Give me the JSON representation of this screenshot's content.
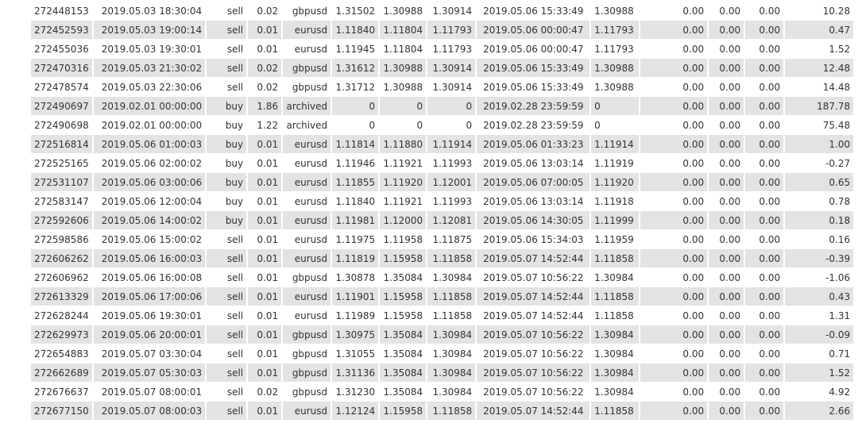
{
  "rows": [
    [
      "272448153",
      "2019.05.03 18:30:04",
      "sell",
      "0.02",
      "gbpusd",
      "1.31502",
      "1.30988",
      "1.30914",
      "2019.05.06 15:33:49",
      "1.30988",
      "0.00",
      "0.00",
      "0.00",
      "10.28"
    ],
    [
      "272452593",
      "2019.05.03 19:00:14",
      "sell",
      "0.01",
      "eurusd",
      "1.11840",
      "1.11804",
      "1.11793",
      "2019.05.06 00:00:47",
      "1.11793",
      "0.00",
      "0.00",
      "0.00",
      "0.47"
    ],
    [
      "272455036",
      "2019.05.03 19:30:01",
      "sell",
      "0.01",
      "eurusd",
      "1.11945",
      "1.11804",
      "1.11793",
      "2019.05.06 00:00:47",
      "1.11793",
      "0.00",
      "0.00",
      "0.00",
      "1.52"
    ],
    [
      "272470316",
      "2019.05.03 21:30:02",
      "sell",
      "0.02",
      "gbpusd",
      "1.31612",
      "1.30988",
      "1.30914",
      "2019.05.06 15:33:49",
      "1.30988",
      "0.00",
      "0.00",
      "0.00",
      "12.48"
    ],
    [
      "272478574",
      "2019.05.03 22:30:06",
      "sell",
      "0.02",
      "gbpusd",
      "1.31712",
      "1.30988",
      "1.30914",
      "2019.05.06 15:33:49",
      "1.30988",
      "0.00",
      "0.00",
      "0.00",
      "14.48"
    ],
    [
      "272490697",
      "2019.02.01 00:00:00",
      "buy",
      "1.86",
      "archived",
      "0",
      "0",
      "0",
      "2019.02.28 23:59:59",
      "0",
      "0.00",
      "0.00",
      "0.00",
      "187.78"
    ],
    [
      "272490698",
      "2019.02.01 00:00:00",
      "buy",
      "1.22",
      "archived",
      "0",
      "0",
      "0",
      "2019.02.28 23:59:59",
      "0",
      "0.00",
      "0.00",
      "0.00",
      "75.48"
    ],
    [
      "272516814",
      "2019.05.06 01:00:03",
      "buy",
      "0.01",
      "eurusd",
      "1.11814",
      "1.11880",
      "1.11914",
      "2019.05.06 01:33:23",
      "1.11914",
      "0.00",
      "0.00",
      "0.00",
      "1.00"
    ],
    [
      "272525165",
      "2019.05.06 02:00:02",
      "buy",
      "0.01",
      "eurusd",
      "1.11946",
      "1.11921",
      "1.11993",
      "2019.05.06 13:03:14",
      "1.11919",
      "0.00",
      "0.00",
      "0.00",
      "-0.27"
    ],
    [
      "272531107",
      "2019.05.06 03:00:06",
      "buy",
      "0.01",
      "eurusd",
      "1.11855",
      "1.11920",
      "1.12001",
      "2019.05.06 07:00:05",
      "1.11920",
      "0.00",
      "0.00",
      "0.00",
      "0.65"
    ],
    [
      "272583147",
      "2019.05.06 12:00:04",
      "buy",
      "0.01",
      "eurusd",
      "1.11840",
      "1.11921",
      "1.11993",
      "2019.05.06 13:03:14",
      "1.11918",
      "0.00",
      "0.00",
      "0.00",
      "0.78"
    ],
    [
      "272592606",
      "2019.05.06 14:00:02",
      "buy",
      "0.01",
      "eurusd",
      "1.11981",
      "1.12000",
      "1.12081",
      "2019.05.06 14:30:05",
      "1.11999",
      "0.00",
      "0.00",
      "0.00",
      "0.18"
    ],
    [
      "272598586",
      "2019.05.06 15:00:02",
      "sell",
      "0.01",
      "eurusd",
      "1.11975",
      "1.11958",
      "1.11875",
      "2019.05.06 15:34:03",
      "1.11959",
      "0.00",
      "0.00",
      "0.00",
      "0.16"
    ],
    [
      "272606262",
      "2019.05.06 16:00:03",
      "sell",
      "0.01",
      "eurusd",
      "1.11819",
      "1.15958",
      "1.11858",
      "2019.05.07 14:52:44",
      "1.11858",
      "0.00",
      "0.00",
      "0.00",
      "-0.39"
    ],
    [
      "272606962",
      "2019.05.06 16:00:08",
      "sell",
      "0.01",
      "gbpusd",
      "1.30878",
      "1.35084",
      "1.30984",
      "2019.05.07 10:56:22",
      "1.30984",
      "0.00",
      "0.00",
      "0.00",
      "-1.06"
    ],
    [
      "272613329",
      "2019.05.06 17:00:06",
      "sell",
      "0.01",
      "eurusd",
      "1.11901",
      "1.15958",
      "1.11858",
      "2019.05.07 14:52:44",
      "1.11858",
      "0.00",
      "0.00",
      "0.00",
      "0.43"
    ],
    [
      "272628244",
      "2019.05.06 19:30:01",
      "sell",
      "0.01",
      "eurusd",
      "1.11989",
      "1.15958",
      "1.11858",
      "2019.05.07 14:52:44",
      "1.11858",
      "0.00",
      "0.00",
      "0.00",
      "1.31"
    ],
    [
      "272629973",
      "2019.05.06 20:00:01",
      "sell",
      "0.01",
      "gbpusd",
      "1.30975",
      "1.35084",
      "1.30984",
      "2019.05.07 10:56:22",
      "1.30984",
      "0.00",
      "0.00",
      "0.00",
      "-0.09"
    ],
    [
      "272654883",
      "2019.05.07 03:30:04",
      "sell",
      "0.01",
      "gbpusd",
      "1.31055",
      "1.35084",
      "1.30984",
      "2019.05.07 10:56:22",
      "1.30984",
      "0.00",
      "0.00",
      "0.00",
      "0.71"
    ],
    [
      "272662689",
      "2019.05.07 05:30:03",
      "sell",
      "0.01",
      "gbpusd",
      "1.31136",
      "1.35084",
      "1.30984",
      "2019.05.07 10:56:22",
      "1.30984",
      "0.00",
      "0.00",
      "0.00",
      "1.52"
    ],
    [
      "272676637",
      "2019.05.07 08:00:01",
      "sell",
      "0.02",
      "gbpusd",
      "1.31230",
      "1.35084",
      "1.30984",
      "2019.05.07 10:56:22",
      "1.30984",
      "0.00",
      "0.00",
      "0.00",
      "4.92"
    ],
    [
      "272677150",
      "2019.05.07 08:00:03",
      "sell",
      "0.01",
      "eurusd",
      "1.12124",
      "1.15958",
      "1.11858",
      "2019.05.07 14:52:44",
      "1.11858",
      "0.00",
      "0.00",
      "0.00",
      "2.66"
    ]
  ],
  "colors": {
    "alt_row": "#e3e3e3",
    "text": "#333333"
  }
}
